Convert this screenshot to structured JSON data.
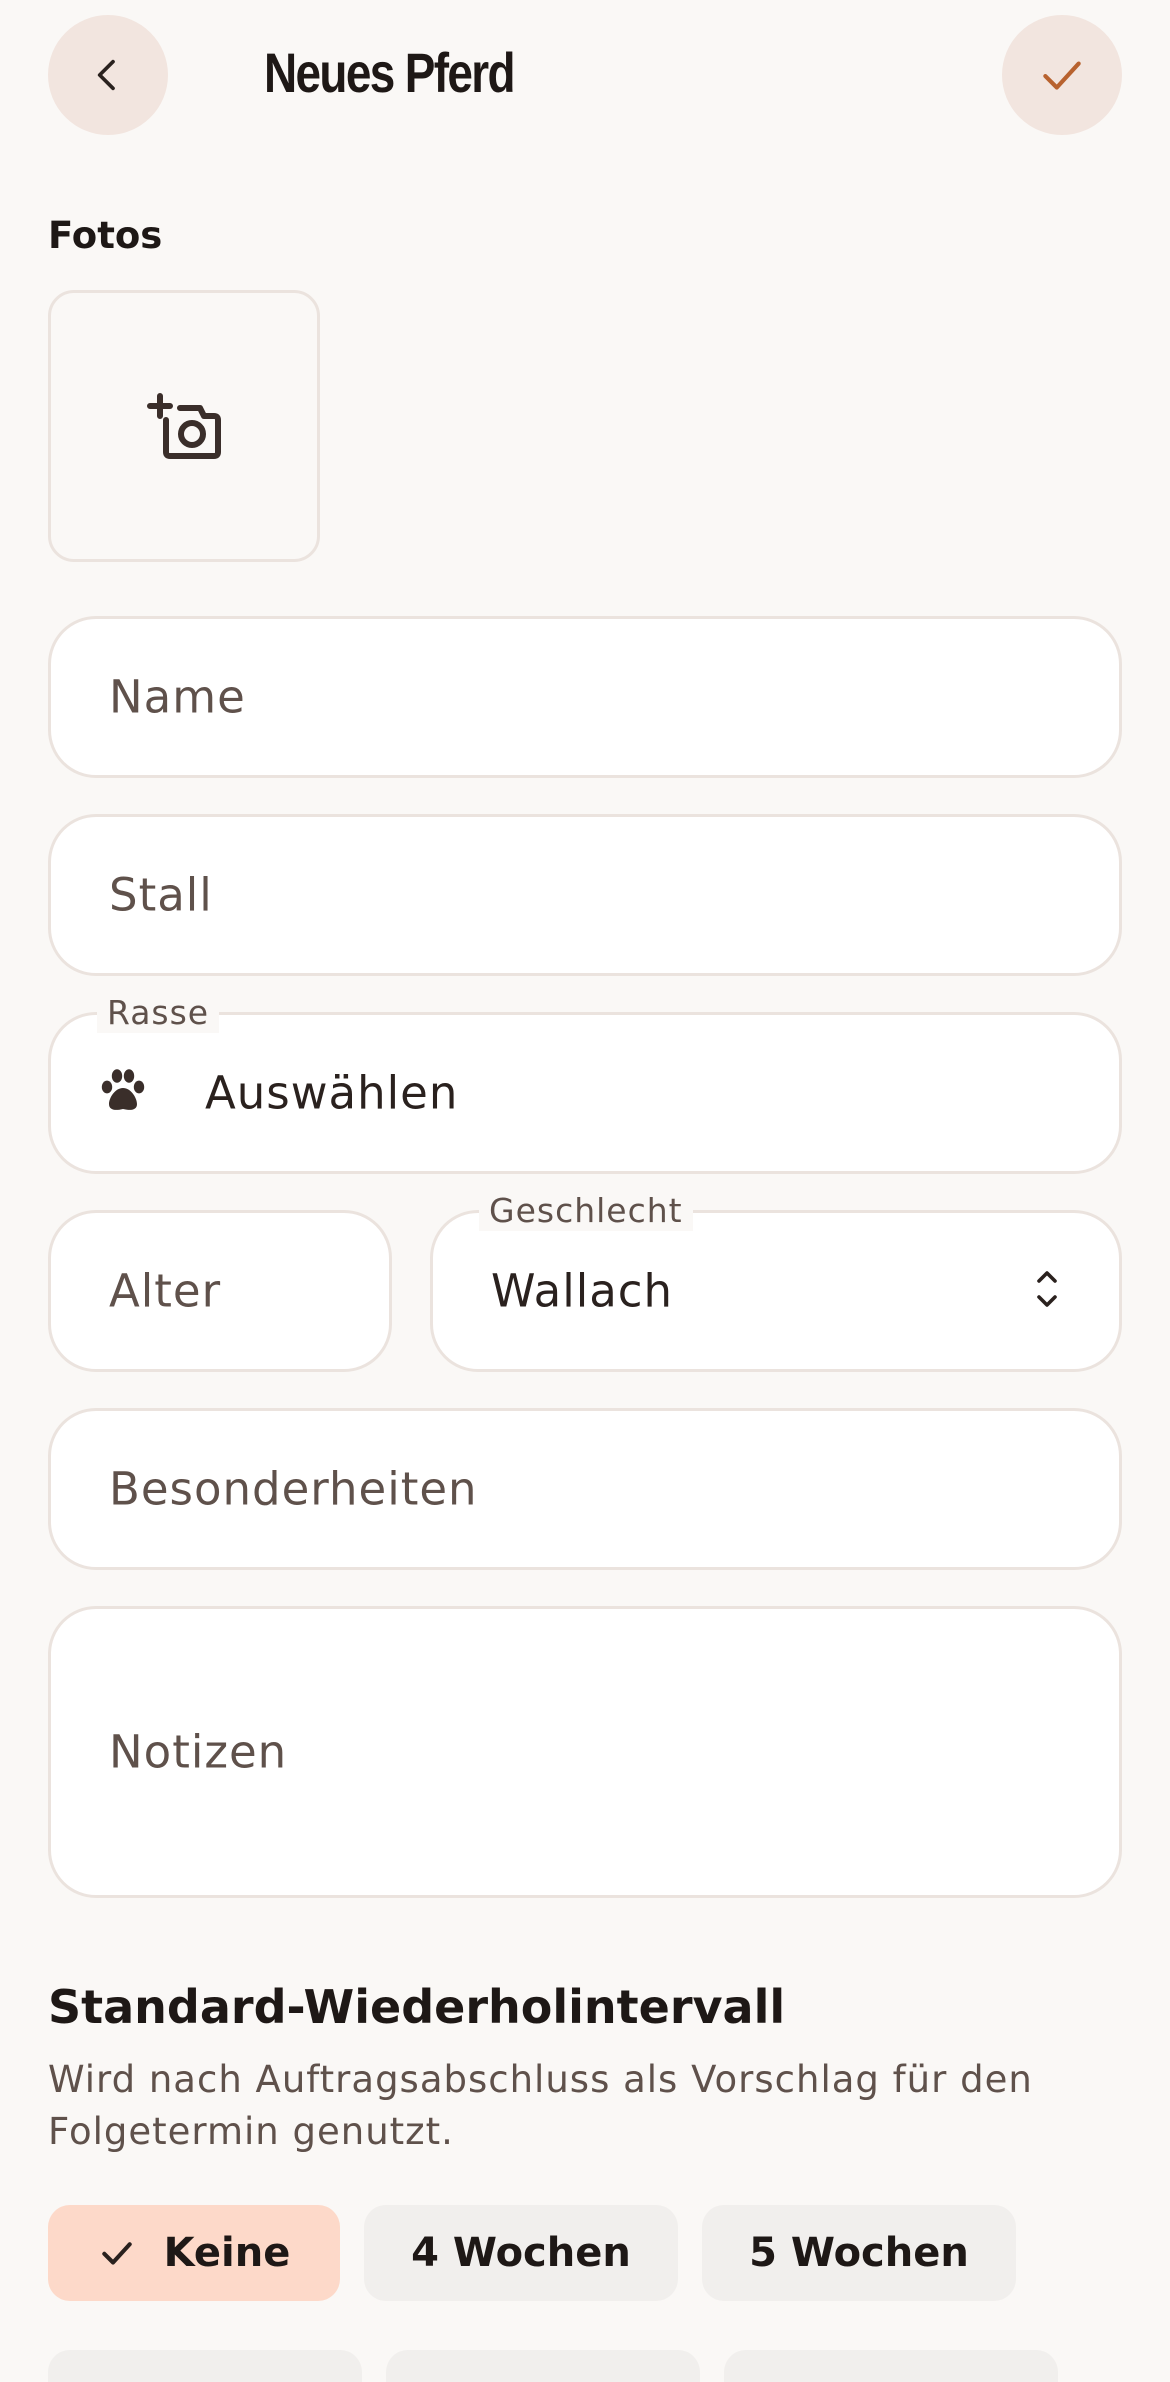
{
  "header": {
    "title": "Neues Pferd",
    "back_icon": "chevron-left-icon",
    "save_icon": "check-icon",
    "accent_color": "#b8622f"
  },
  "photos": {
    "label": "Fotos",
    "add_icon": "add-photo-icon"
  },
  "fields": {
    "name": {
      "placeholder": "Name"
    },
    "stall": {
      "placeholder": "Stall"
    },
    "rasse": {
      "label": "Rasse",
      "value": "Auswählen",
      "icon": "paw-icon"
    },
    "alter": {
      "placeholder": "Alter"
    },
    "geschlecht": {
      "label": "Geschlecht",
      "value": "Wallach",
      "icon": "unfold-icon"
    },
    "besonderheiten": {
      "placeholder": "Besonderheiten"
    },
    "notizen": {
      "placeholder": "Notizen"
    }
  },
  "interval": {
    "title": "Standard-Wiederholintervall",
    "description": "Wird nach Auftragsabschluss als Vorschlag für den Folgetermin genutzt.",
    "options": [
      {
        "label": "Keine",
        "selected": true
      },
      {
        "label": "4 Wochen",
        "selected": false
      },
      {
        "label": "5 Wochen",
        "selected": false
      }
    ],
    "selected_color": "#fdd9c9"
  }
}
